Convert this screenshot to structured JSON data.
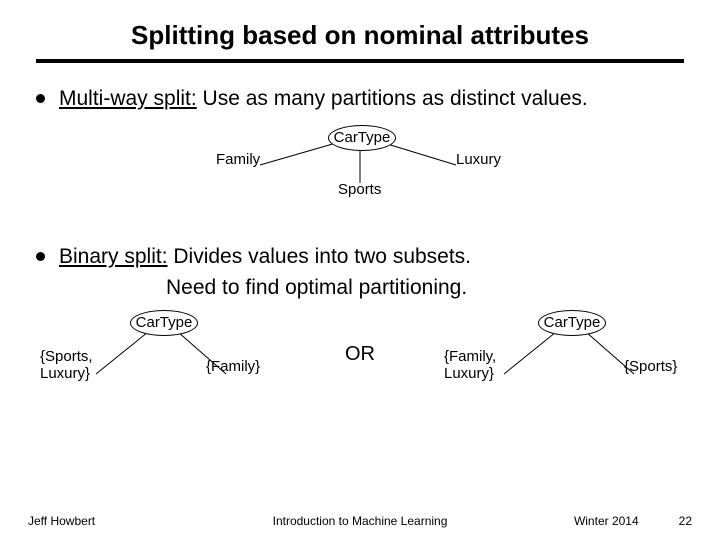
{
  "title": "Splitting based on nominal attributes",
  "bullets": {
    "multiway_label": "Multi-way split:",
    "multiway_rest": " Use as many partitions as distinct values.",
    "binary_label": "Binary split:",
    "binary_line1": "  Divides values into two subsets.",
    "binary_line2": "Need to find optimal partitioning."
  },
  "tree_multiway": {
    "node": "CarType",
    "left": "Family",
    "mid": "Sports",
    "right": "Luxury"
  },
  "tree_binary_left": {
    "node": "CarType",
    "left": "{Sports,\nLuxury}",
    "right": "{Family}"
  },
  "or_label": "OR",
  "tree_binary_right": {
    "node": "CarType",
    "left": "{Family,\nLuxury}",
    "right": "{Sports}"
  },
  "footer": {
    "left": "Jeff Howbert",
    "center": "Introduction to Machine Learning",
    "right_term": "Winter 2014",
    "page": "22"
  }
}
